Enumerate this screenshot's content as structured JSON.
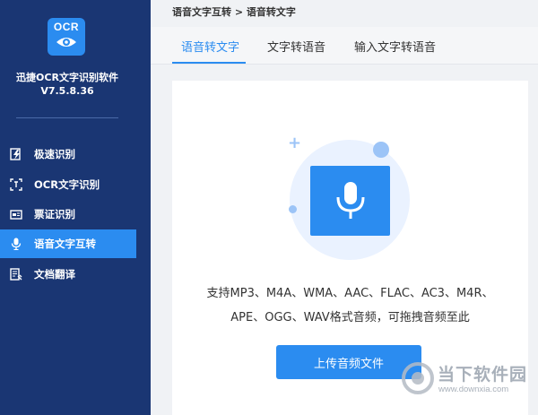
{
  "sidebar": {
    "logo_text": "OCR",
    "app_name": "迅捷OCR文字识别软件",
    "version": "V7.5.8.36",
    "items": [
      {
        "label": "极速识别",
        "icon": "fast-scan-icon",
        "active": false
      },
      {
        "label": "OCR文字识别",
        "icon": "ocr-scan-icon",
        "active": false
      },
      {
        "label": "票证识别",
        "icon": "ticket-icon",
        "active": false
      },
      {
        "label": "语音文字互转",
        "icon": "microphone-icon",
        "active": true
      },
      {
        "label": "文档翻译",
        "icon": "document-translate-icon",
        "active": false
      }
    ]
  },
  "breadcrumb": "语音文字互转 > 语音转文字",
  "tabs": [
    {
      "label": "语音转文字",
      "active": true
    },
    {
      "label": "文字转语音",
      "active": false
    },
    {
      "label": "输入文字转语音",
      "active": false
    }
  ],
  "main": {
    "description_line1": "支持MP3、M4A、WMA、AAC、FLAC、AC3、M4R、",
    "description_line2": "APE、OGG、WAV格式音频，可拖拽音频至此",
    "upload_label": "上传音频文件"
  },
  "watermark": {
    "title": "当下软件园",
    "url": "www.downxia.com"
  },
  "colors": {
    "sidebar_bg": "#1a3673",
    "accent": "#2b8cf0",
    "panel_bg": "#ffffff",
    "tabbar_bg": "#f5f6f8"
  }
}
